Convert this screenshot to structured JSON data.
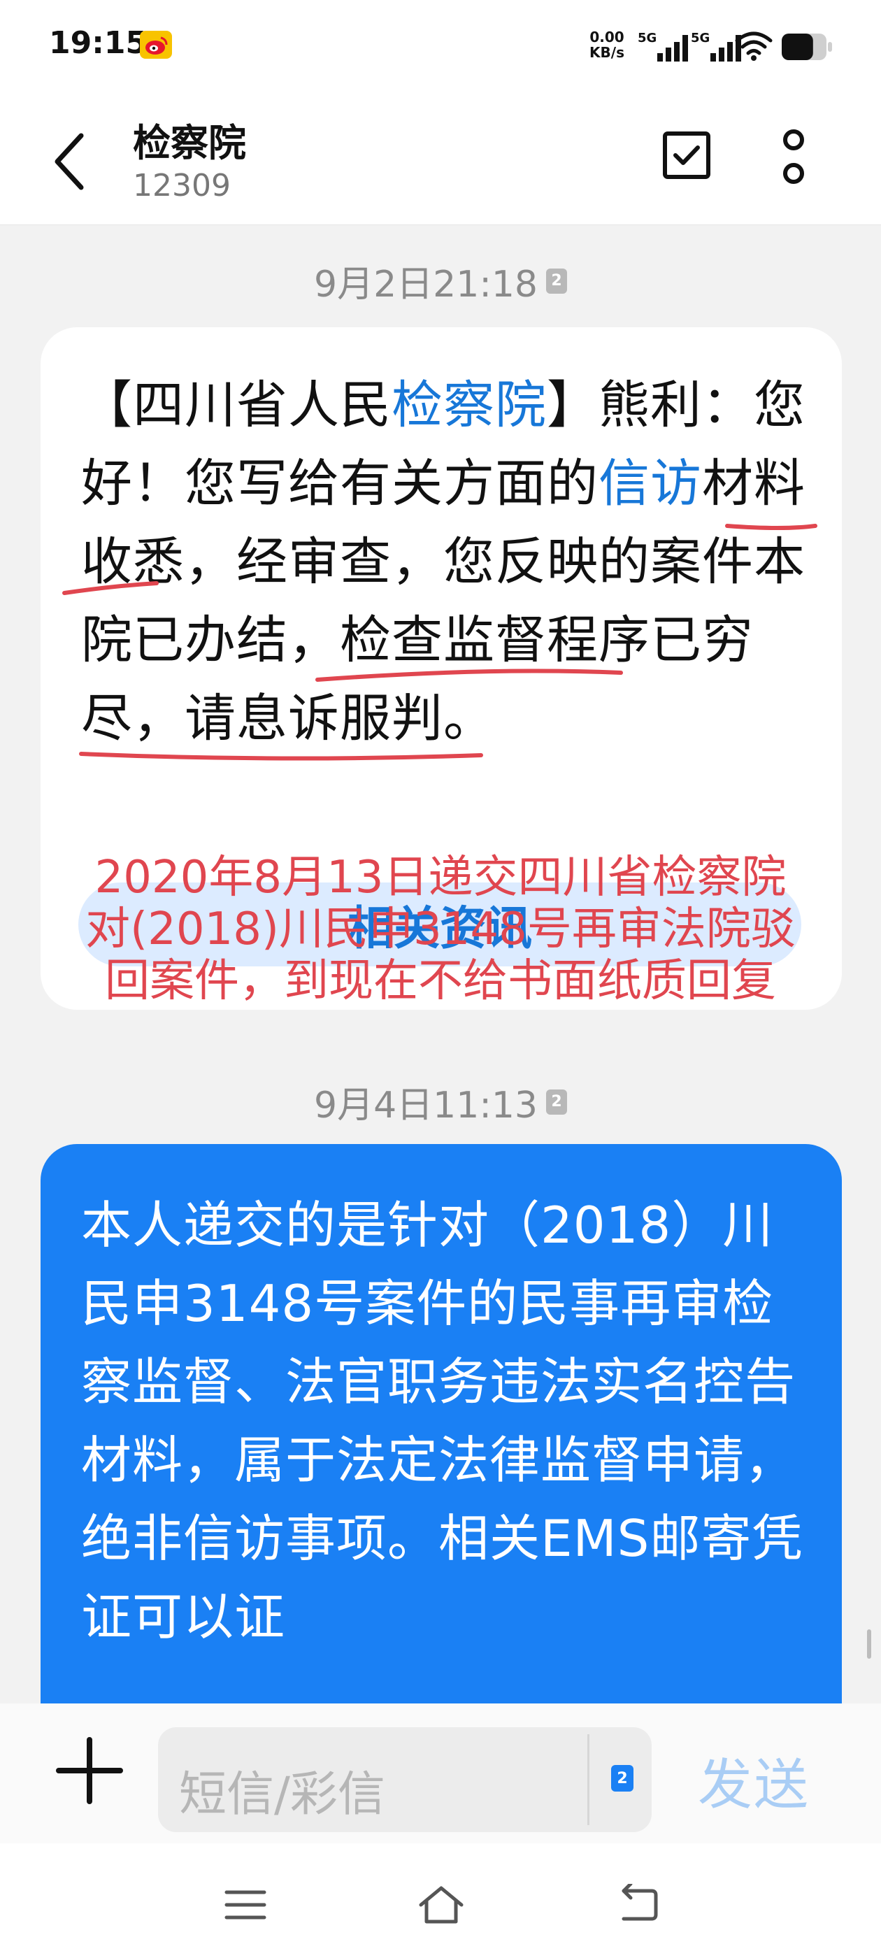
{
  "status_bar": {
    "time": "19:15",
    "net_speed_value": "0.00",
    "net_speed_unit": "KB/s",
    "sim1_label": "5G",
    "sim2_label": "5G",
    "battery_level": 0.7
  },
  "header": {
    "contact_name": "检察院",
    "contact_number": "12309"
  },
  "messages": [
    {
      "direction": "incoming",
      "timestamp": "9月2日21:18",
      "sim": "2",
      "text_parts": [
        "【四川省人民",
        "检察院",
        "】熊利：您好！您写给有关方面的",
        "信访",
        "材料收悉，经审查，您反映的案件本院已办结，检查监督程序已穷尽，请息诉服判。"
      ],
      "link_label": "相关资讯",
      "annotation": "2020年8月13日递交四川省检察院对(2018)川民申3148号再审法院驳回案件，到现在不给书面纸质回复"
    },
    {
      "direction": "outgoing",
      "timestamp": "9月4日11:13",
      "sim": "2",
      "text": "本人递交的是针对（2018）川民申3148号案件的民事再审检察监督、法官职务违法实名控告材料，属于法定法律监督申请，绝非信访事项。相关EMS邮寄凭证可以证"
    }
  ],
  "composer": {
    "placeholder": "短信/彩信",
    "sim": "2",
    "send_label": "发送"
  },
  "colors": {
    "accent": "#1A80F4",
    "annotation": "#E0464F",
    "highlight": "#1777D8"
  },
  "icons": [
    "weibo-icon",
    "signal-icon",
    "wifi-icon",
    "battery-icon",
    "back-icon",
    "select-icon",
    "more-icon",
    "add-icon",
    "menu-icon",
    "home-icon",
    "back-nav-icon"
  ]
}
